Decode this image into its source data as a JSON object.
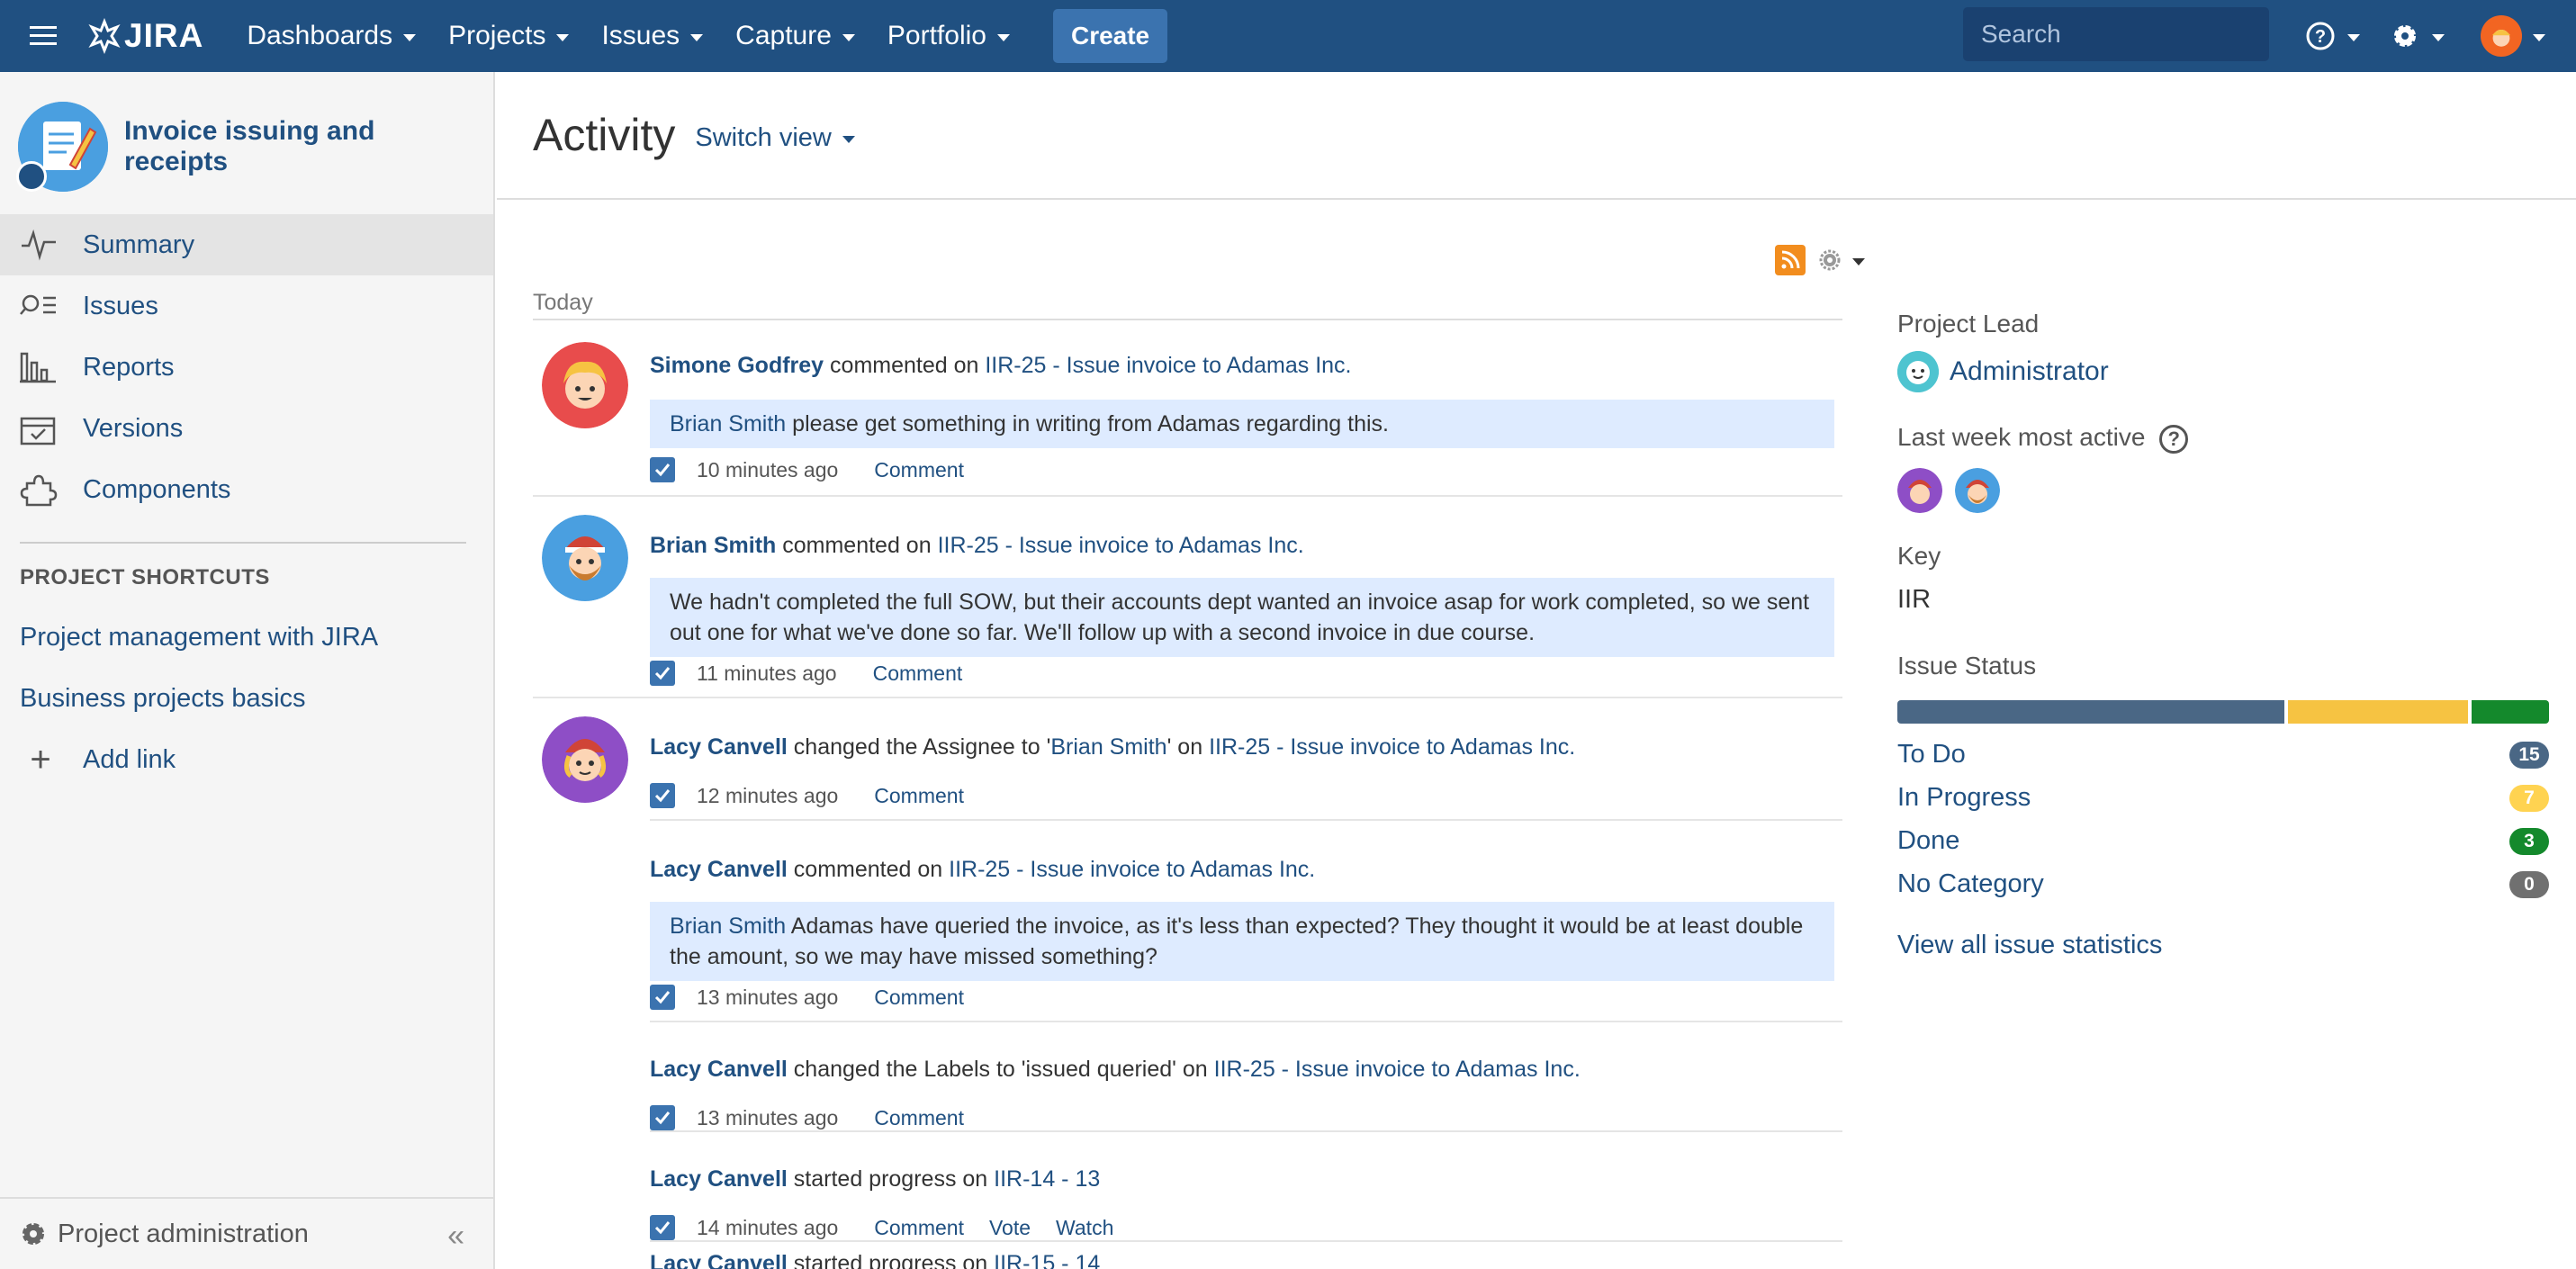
{
  "topnav": {
    "logo_text": "JIRA",
    "items": [
      "Dashboards",
      "Projects",
      "Issues",
      "Capture",
      "Portfolio"
    ],
    "create_label": "Create",
    "search_placeholder": "Search"
  },
  "sidebar": {
    "project_name": "Invoice issuing and receipts",
    "nav": [
      {
        "label": "Summary",
        "icon": "summary-icon",
        "active": true
      },
      {
        "label": "Issues",
        "icon": "issues-icon"
      },
      {
        "label": "Reports",
        "icon": "reports-icon"
      },
      {
        "label": "Versions",
        "icon": "versions-icon"
      },
      {
        "label": "Components",
        "icon": "components-icon"
      }
    ],
    "shortcuts_heading": "PROJECT SHORTCUTS",
    "shortcuts": [
      "Project management with JIRA",
      "Business projects basics"
    ],
    "add_link": "Add link",
    "project_admin": "Project administration"
  },
  "main": {
    "title": "Activity",
    "switch_view": "Switch view",
    "today_label": "Today",
    "entries": [
      {
        "user": "Simone Godfrey",
        "verb": " commented on ",
        "issue": "IIR-25 - Issue invoice to Adamas Inc.",
        "quote_mention": "Brian Smith",
        "quote_text": " please get something in writing from Adamas regarding this.",
        "time": "10 minutes ago",
        "actions": [
          "Comment"
        ]
      },
      {
        "user": "Brian Smith",
        "verb": " commented on ",
        "issue": "IIR-25 - Issue invoice to Adamas Inc.",
        "quote_text": "We hadn't completed the full SOW, but their accounts dept wanted an invoice asap for work completed, so we sent out one for what we've done so far. We'll follow up with a second invoice in due course.",
        "time": "11 minutes ago",
        "actions": [
          "Comment"
        ]
      },
      {
        "user": "Lacy Canvell",
        "verb": " changed the Assignee to '",
        "assignee": "Brian Smith",
        "verb2": "' on ",
        "issue": "IIR-25 - Issue invoice to Adamas Inc.",
        "time": "12 minutes ago",
        "actions": [
          "Comment"
        ]
      },
      {
        "user": "Lacy Canvell",
        "verb": " commented on ",
        "issue": "IIR-25 - Issue invoice to Adamas Inc.",
        "quote_mention": "Brian Smith",
        "quote_text": " Adamas have queried the invoice, as it's less than expected? They thought it would be at least double the amount, so we may have missed something?",
        "time": "13 minutes ago",
        "actions": [
          "Comment"
        ]
      },
      {
        "user": "Lacy Canvell",
        "verb": " changed the Labels to 'issued queried' on ",
        "issue": "IIR-25 - Issue invoice to Adamas Inc.",
        "time": "13 minutes ago",
        "actions": [
          "Comment"
        ]
      },
      {
        "user": "Lacy Canvell",
        "verb": " started progress on ",
        "issue": "IIR-14 - 13",
        "time": "14 minutes ago",
        "actions": [
          "Comment",
          "Vote",
          "Watch"
        ]
      },
      {
        "user": "Lacy Canvell",
        "verb": " started progress on ",
        "issue": "IIR-15 - 14"
      }
    ]
  },
  "right": {
    "project_lead_label": "Project Lead",
    "project_lead": "Administrator",
    "most_active_label": "Last week most active",
    "key_label": "Key",
    "key_value": "IIR",
    "issue_status_label": "Issue Status",
    "statuses": [
      {
        "name": "To Do",
        "count": "15",
        "color": "#4a6785"
      },
      {
        "name": "In Progress",
        "count": "7",
        "color": "#ffd351"
      },
      {
        "name": "Done",
        "count": "3",
        "color": "#14892c"
      },
      {
        "name": "No Category",
        "count": "0",
        "color": "#707070"
      }
    ],
    "view_all": "View all issue statistics"
  },
  "colors": {
    "header_bg": "#205081",
    "link": "#205081",
    "create_btn": "#3b73af",
    "todo": "#4a6785",
    "in_progress": "#f6c342",
    "done": "#14892c"
  }
}
